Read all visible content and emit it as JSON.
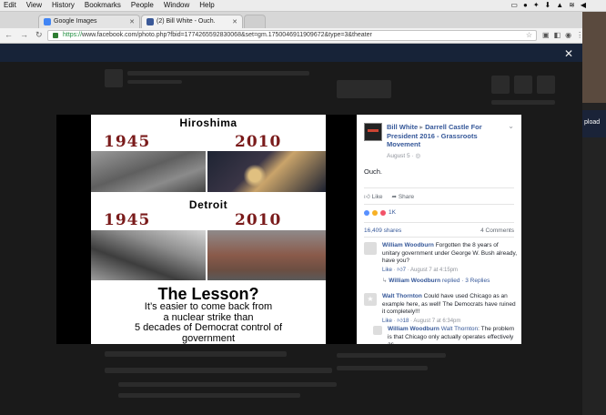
{
  "mac_menu": [
    "Edit",
    "View",
    "History",
    "Bookmarks",
    "People",
    "Window",
    "Help"
  ],
  "tabs": [
    {
      "title": "Google Images",
      "favicon_color": "#4285f4"
    },
    {
      "title": "(2) Bill White - Ouch.",
      "favicon_color": "#3b5998"
    }
  ],
  "address_bar": {
    "scheme": "https://",
    "rest": "www.facebook.com/photo.php?fbid=1774265592830068&set=gm.1750046911909672&type=3&theater"
  },
  "right_strip": {
    "label": "pload"
  },
  "photo": {
    "city1": "Hiroshima",
    "city2": "Detroit",
    "year_a": "1945",
    "year_b": "2010",
    "headline": "The Lesson?",
    "body_lines": [
      "It’s easier to come back from",
      "a nuclear strike than",
      "5 decades of Democrat control of",
      "government"
    ]
  },
  "post": {
    "author": "Bill White",
    "arrow": "▸",
    "group": "Darrell Castle For President 2016 - Grassroots Movement",
    "date": "August 5 · ",
    "text": "Ouch.",
    "like_label": "Like",
    "share_label": "Share",
    "reaction_count": "1K",
    "shares": "16,409 shares",
    "comments_count": "4 Comments"
  },
  "comments": [
    {
      "name": "William Woodburn",
      "text": "Forgotten the 8 years of unitary government under George W. Bush already, have you?",
      "like": "Like",
      "reactions": "7",
      "time": "August 7 at 4:15pm",
      "replier": "William Woodburn",
      "replied": "replied",
      "replies": "3 Replies"
    },
    {
      "name": "Walt Thornton",
      "text": "Could have used Chicago as an example here, as well! The Democrats have ruined it completely!!!",
      "like": "Like",
      "reactions": "18",
      "time": "August 7 at 6:34pm"
    },
    {
      "name": "William Woodburn",
      "mention": "Walt Thornton",
      "text": ": The problem is that Chicago only actually operates effectively as"
    }
  ],
  "colors": {
    "fb_link": "#365899",
    "year_red": "#7a1b1b",
    "page_dim": "#1a1a1a"
  }
}
